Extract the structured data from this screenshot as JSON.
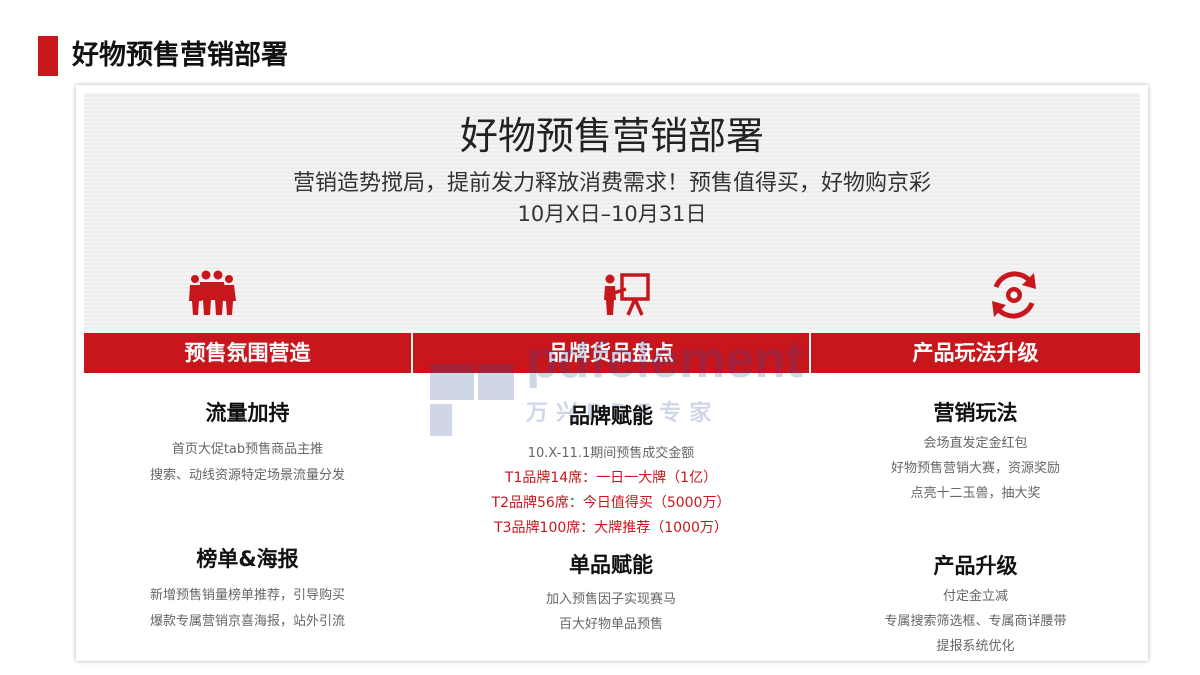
{
  "page": {
    "title": "好物预售营销部署"
  },
  "card": {
    "title": "好物预售营销部署",
    "subtitle": "营销造势搅局，提前发力释放消费需求！预售值得买，好物购京彩",
    "date_range": "10月X日–10月31日"
  },
  "watermark": {
    "line1": "pdfelement",
    "line2": "万兴PDF专家"
  },
  "icons": [
    "people-group-icon",
    "presentation-board-icon",
    "refresh-target-icon"
  ],
  "colors": {
    "accent": "#c8161d"
  },
  "columns": [
    {
      "header": "预售氛围营造",
      "sections": [
        {
          "title": "流量加持",
          "lines": [
            "首页大促tab预售商品主推",
            "搜索、动线资源特定场景流量分发"
          ]
        },
        {
          "title": "榜单&海报",
          "lines": [
            "新增预售销量榜单推荐，引导购买",
            "爆款专属营销京喜海报，站外引流"
          ]
        }
      ]
    },
    {
      "header": "品牌货品盘点",
      "sections": [
        {
          "title": "品牌赋能",
          "lines": [
            "10.X-11.1期间预售成交金额"
          ],
          "red_lines": [
            "T1品牌14席：一日一大牌（1亿）",
            "T2品牌56席：今日值得买（5000万）",
            "T3品牌100席：大牌推荐（1000万）"
          ]
        },
        {
          "title": "单品赋能",
          "lines": [
            "加入预售因子实现赛马",
            "百大好物单品预售"
          ]
        }
      ]
    },
    {
      "header": "产品玩法升级",
      "sections": [
        {
          "title": "营销玩法",
          "lines": [
            "会场直发定金红包",
            "好物预售营销大赛，资源奖励",
            "点亮十二玉兽，抽大奖"
          ]
        },
        {
          "title": "产品升级",
          "lines": [
            "付定金立减",
            "专属搜索筛选框、专属商详腰带",
            "提报系统优化"
          ]
        }
      ]
    }
  ]
}
